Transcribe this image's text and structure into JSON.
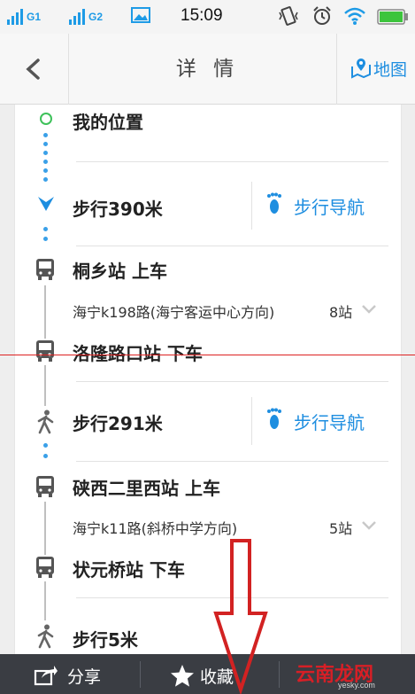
{
  "status_bar": {
    "sim1_label": "G1",
    "sim2_label": "G2",
    "time": "15:09",
    "icons": [
      "signal-icon",
      "signal-icon",
      "image-icon",
      "vibrate-icon",
      "alarm-icon",
      "wifi-icon",
      "battery-icon"
    ],
    "battery_color": "#3cc43c"
  },
  "header": {
    "back_icon": "chevron-left-icon",
    "title": "详 情",
    "map_label": "地图",
    "map_icon": "map-pin-icon"
  },
  "route": {
    "start": {
      "label": "我的位置"
    },
    "walk1": {
      "label": "步行390米",
      "nav_label": "步行导航"
    },
    "board1": {
      "label": "桐乡站 上车",
      "line": "海宁k198路(海宁客运中心方向)",
      "stops": "8站"
    },
    "alight1": {
      "label": "洛隆路口站 下车"
    },
    "walk2": {
      "label": "步行291米",
      "nav_label": "步行导航"
    },
    "board2": {
      "label": "硖西二里西站 上车",
      "line": "海宁k11路(斜桥中学方向)",
      "stops": "5站"
    },
    "alight2": {
      "label": "状元桥站 下车"
    },
    "walk3": {
      "label": "步行5米"
    }
  },
  "toolbar": {
    "share_label": "分享",
    "favorite_label": "收藏"
  },
  "watermark": {
    "brand": "云南龙网",
    "site": "yesky.com"
  },
  "colors": {
    "accent": "#1e8ee0",
    "status_blue": "#1e9be6",
    "toolbar_bg": "#3a3d43",
    "annotation_red": "#d22222"
  }
}
